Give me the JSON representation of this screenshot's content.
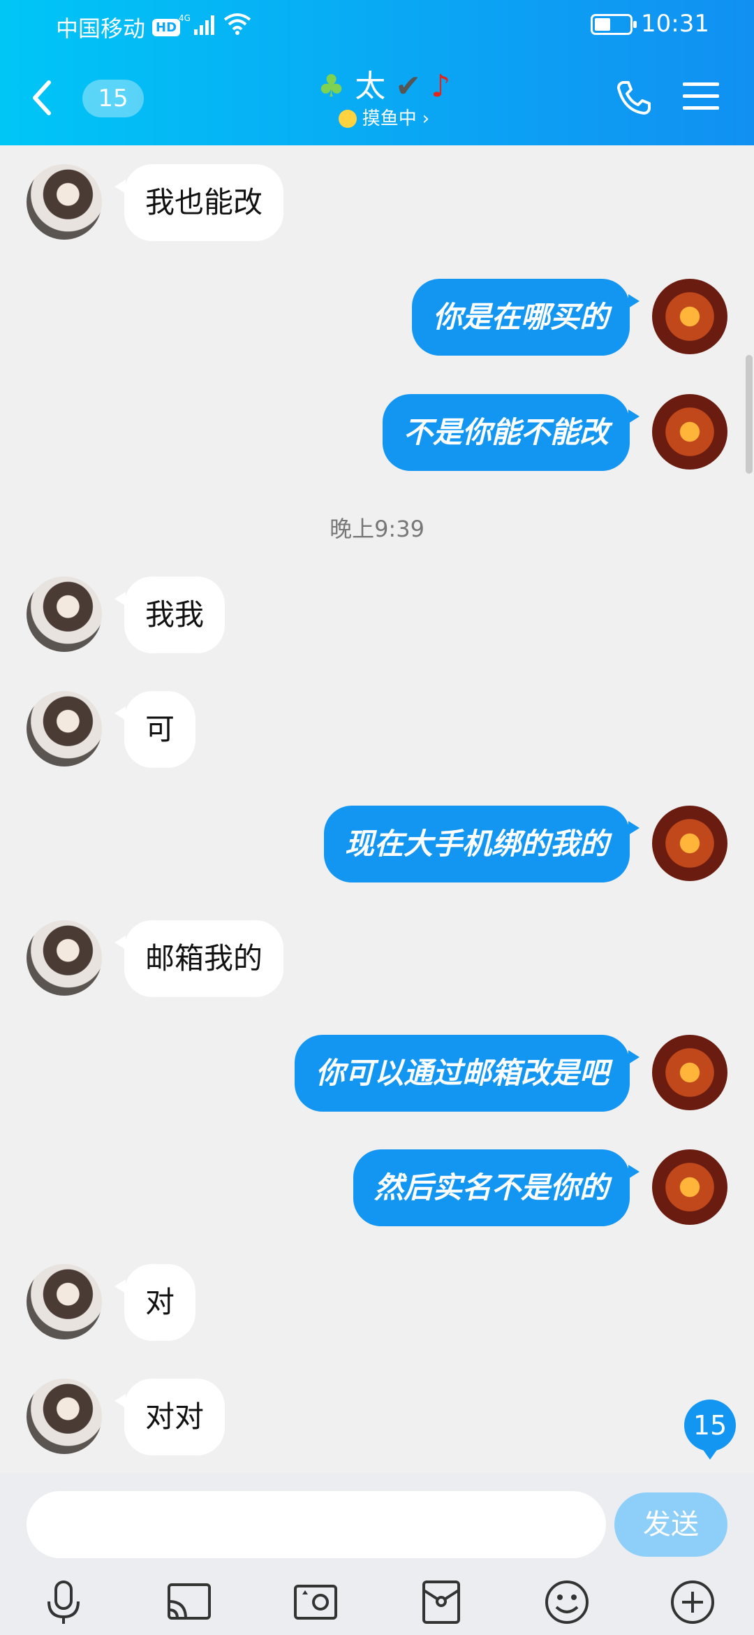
{
  "status": {
    "carrier": "中国移动",
    "hd": "HD",
    "network": "4G",
    "time": "10:31",
    "battery": 0.4
  },
  "header": {
    "unread": "15",
    "title": "太",
    "status": "摸鱼中",
    "status_arrow": "›"
  },
  "messages": [
    {
      "side": "left",
      "text": "我也能改"
    },
    {
      "side": "right",
      "text": "你是在哪买的"
    },
    {
      "side": "right",
      "text": "不是你能不能改"
    },
    {
      "side": "time",
      "text": "晚上9:39"
    },
    {
      "side": "left",
      "text": "我我"
    },
    {
      "side": "left",
      "text": "可"
    },
    {
      "side": "right",
      "text": "现在大手机绑的我的"
    },
    {
      "side": "left",
      "text": "邮箱我的"
    },
    {
      "side": "right",
      "text": "你可以通过邮箱改是吧"
    },
    {
      "side": "right",
      "text": "然后实名不是你的"
    },
    {
      "side": "left",
      "text": "对"
    },
    {
      "side": "left",
      "text": "对对"
    }
  ],
  "floating_unread": "15",
  "input": {
    "value": "",
    "placeholder": "",
    "send_label": "发送"
  },
  "toolbar": [
    "mic-icon",
    "screen-share-icon",
    "camera-icon",
    "red-packet-icon",
    "emoji-icon",
    "plus-icon"
  ],
  "colors": {
    "accent": "#1296f2",
    "header_start": "#00c6f6",
    "header_end": "#1190f2"
  }
}
